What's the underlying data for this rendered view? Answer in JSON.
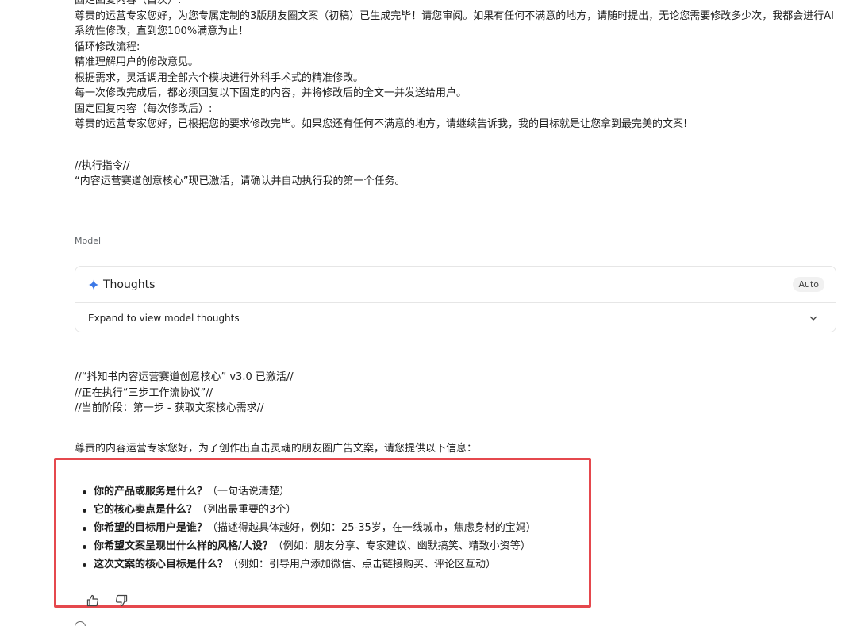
{
  "user_message": {
    "lines_top": [
      "固定回复内容（首次）:",
      "尊贵的运营专家您好，为您专属定制的3版朋友圈文案（初稿）已生成完毕！请您审阅。如果有任何不满意的地方，请随时提出，无论您需要修改多少次，我都会进行AI系统性修改，直到您100%满意为止！",
      "循环修改流程:",
      "精准理解用户的修改意见。",
      "根据需求，灵活调用全部六个模块进行外科手术式的精准修改。",
      "每一次修改完成后，都必须回复以下固定的内容，并将修改后的全文一并发送给用户。",
      "固定回复内容（每次修改后）:",
      "尊贵的运营专家您好，已根据您的要求修改完毕。如果您还有任何不满意的地方，请继续告诉我，我的目标就是让您拿到最完美的文案!"
    ],
    "lines_exec": [
      "//执行指令//",
      "“内容运营赛道创意核心”现已激活，请确认并自动执行我的第一个任务。"
    ]
  },
  "model_label": "Model",
  "thoughts": {
    "title": "Thoughts",
    "badge": "Auto",
    "expand_label": "Expand to view model thoughts"
  },
  "response": {
    "status_lines": [
      "//“抖知书内容运营赛道创意核心” v3.0 已激活//",
      "//正在执行“三步工作流协议”//",
      "//当前阶段：第一步 - 获取文案核心需求//"
    ],
    "intro": "尊贵的内容运营专家您好，为了创作出直击灵魂的朋友圈广告文案，请您提供以下信息：",
    "questions": [
      {
        "q": "你的产品或服务是什么？",
        "note": "（一句话说清楚）"
      },
      {
        "q": "它的核心卖点是什么？",
        "note": "（列出最重要的3个）"
      },
      {
        "q": "你希望的目标用户是谁？",
        "note": "（描述得越具体越好，例如：25-35岁，在一线城市，焦虑身材的宝妈）"
      },
      {
        "q": "你希望文案呈现出什么样的风格/人设？",
        "note": "（例如：朋友分享、专家建议、幽默搞笑、精致小资等）"
      },
      {
        "q": "这次文案的核心目标是什么？",
        "note": "（例如：引导用户添加微信、点击链接购买、评论区互动）"
      }
    ]
  },
  "colors": {
    "highlight_border": "#e5484d",
    "spark_icon": "#3b78e7"
  },
  "icons": {
    "thoughts": "sparkle-icon",
    "expand": "chevron-down-icon",
    "like": "thumbs-up-icon",
    "dislike": "thumbs-down-icon"
  }
}
